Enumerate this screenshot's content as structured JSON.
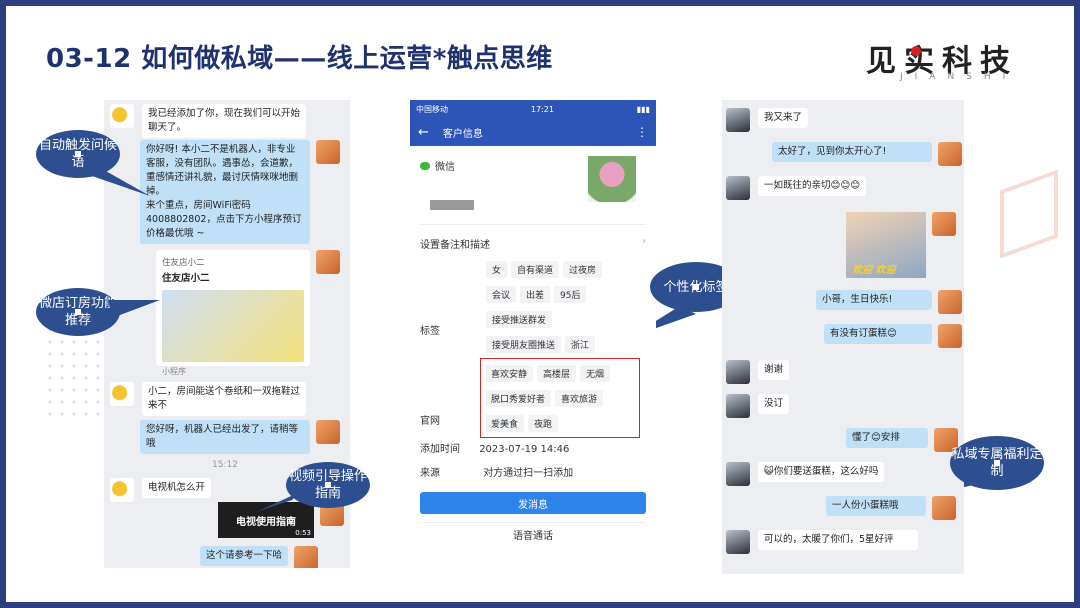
{
  "slide": {
    "title": "03-12 如何做私域——线上运营*触点思维",
    "logo": "见实科技",
    "logo_sub": "JIANSHI"
  },
  "left_chat": {
    "msg1": "我已经添加了你，现在我们可以开始聊天了。",
    "msg2_lines": [
      "你好呀! 本小二不是机器人，非专业客服，没有团队。遇事怂，会道歉，重感情还讲礼貌，最讨厌情咪咪地删掉。",
      "来个重点，房间WiFi密码4008802802，点击下方小程序预订价格最优哦 ~"
    ],
    "wifi_number": "4008802802",
    "card_header": "住友店小二",
    "card_title": "住友店小二",
    "card_footer": "小程序",
    "msg3": "小二，房间能送个卷纸和一双拖鞋过来不",
    "msg4": "您好呀，机器人已经出发了，请稍等哦",
    "time": "15:12",
    "msg5": "电视机怎么开",
    "video_caption": "电视使用指南",
    "video_duration": "0:53",
    "msg6": "这个请参考一下哈"
  },
  "callouts": {
    "c1": "自动触发问候语",
    "c2": "微店订房功能推荐",
    "c3": "视频引导操作指南",
    "c4": "个性化标签",
    "c5": "私域专属福利定制"
  },
  "customer_info": {
    "status_time": "17:21",
    "status_left": "中国移动",
    "header": "客户信息",
    "channel": "微信",
    "remark_label": "设置备注和描述",
    "tags_label": "标签",
    "tags_row1": [
      "女",
      "自有渠道",
      "过夜房"
    ],
    "tags_row2": [
      "会议",
      "出差",
      "95后"
    ],
    "tags_row3": [
      "接受推送群发"
    ],
    "tags_row4": [
      "接受朋友圈推送",
      "浙江"
    ],
    "tags_highlight": [
      "喜欢安静",
      "高楼层",
      "无烟",
      "脱口秀爱好者",
      "喜欢旅游",
      "爱美食",
      "夜跑"
    ],
    "website_label": "官网",
    "add_time_label": "添加时间",
    "add_time_value": "2023-07-19 14:46",
    "source_label": "来源",
    "source_value": "对方通过扫一扫添加",
    "send_button": "发消息",
    "voice_button": "语音通话"
  },
  "right_chat": {
    "m1": "我又来了",
    "m2": "太好了，见到你太开心了!",
    "m3": "一如既往的亲切😊😊😊",
    "sticker": "欢迎 欢迎",
    "m4": "小哥，生日快乐!",
    "m5": "有没有订蛋糕😊",
    "m6": "谢谢",
    "m7": "没订",
    "m8": "懂了😊安排",
    "m9": "😺你们要送蛋糕，这么好吗",
    "m10": "一人份小蛋糕哦",
    "m11": "可以的，太暖了你们，5星好评"
  }
}
